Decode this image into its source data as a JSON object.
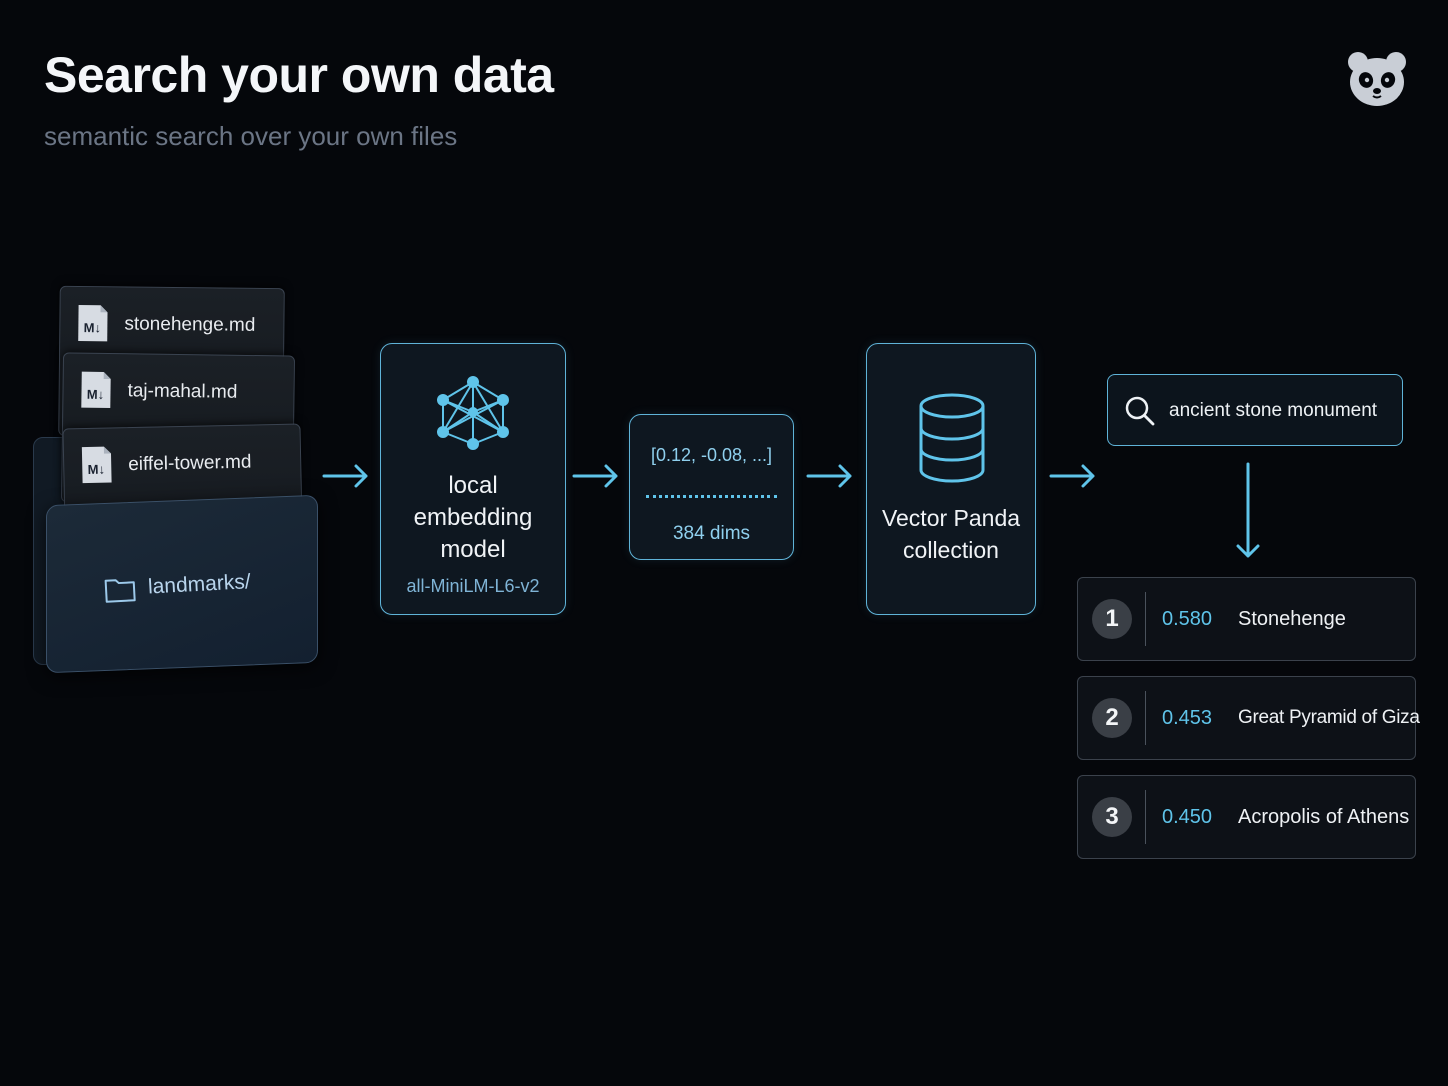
{
  "header": {
    "title": "Search your own data",
    "subtitle": "semantic search over your own files"
  },
  "icons": {
    "logo": "panda-icon",
    "file": "markdown-icon",
    "folder": "folder-icon",
    "model": "neural-network-icon",
    "database": "database-icon",
    "search": "search-icon"
  },
  "files": [
    {
      "name": "stonehenge.md"
    },
    {
      "name": "taj-mahal.md"
    },
    {
      "name": "eiffel-tower.md"
    }
  ],
  "folder": {
    "label": "landmarks/"
  },
  "model": {
    "title_lines": [
      "local",
      "embedding",
      "model"
    ],
    "name": "all-MiniLM-L6-v2"
  },
  "vector": {
    "preview": "[0.12, -0.08, ...]",
    "dims": "384 dims"
  },
  "collection": {
    "title_lines": [
      "Vector Panda",
      "collection"
    ]
  },
  "query": {
    "text": "ancient stone monument"
  },
  "results": [
    {
      "rank": "1",
      "score": "0.580",
      "name": "Stonehenge"
    },
    {
      "rank": "2",
      "score": "0.453",
      "name": "Great Pyramid of Giza"
    },
    {
      "rank": "3",
      "score": "0.450",
      "name": "Acropolis of Athens"
    }
  ],
  "colors": {
    "accent": "#5fb3d8",
    "score": "#5fc4ea",
    "background": "#05070b"
  }
}
